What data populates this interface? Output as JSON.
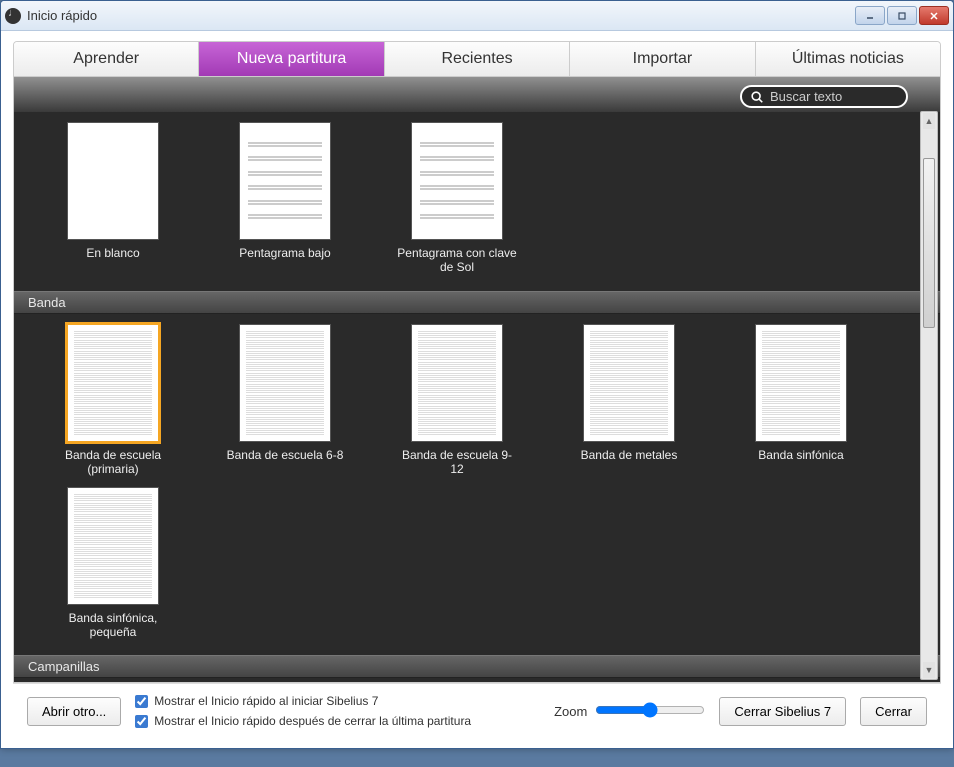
{
  "window": {
    "title": "Inicio rápido"
  },
  "tabs": [
    {
      "label": "Aprender"
    },
    {
      "label": "Nueva partitura",
      "active": true
    },
    {
      "label": "Recientes"
    },
    {
      "label": "Importar"
    },
    {
      "label": "Últimas noticias"
    }
  ],
  "search": {
    "placeholder": "Buscar texto"
  },
  "section_top_items": [
    {
      "label": "En blanco",
      "style": "blank"
    },
    {
      "label": "Pentagrama bajo",
      "style": "sparse"
    },
    {
      "label": "Pentagrama con clave de Sol",
      "style": "sparse"
    }
  ],
  "section_banda": {
    "title": "Banda",
    "items": [
      {
        "label": "Banda de escuela (primaria)",
        "style": "dense",
        "selected": true
      },
      {
        "label": "Banda de escuela 6-8",
        "style": "dense"
      },
      {
        "label": "Banda de escuela 9-12",
        "style": "dense"
      },
      {
        "label": "Banda de metales",
        "style": "dense"
      },
      {
        "label": "Banda sinfónica",
        "style": "dense"
      },
      {
        "label": "Banda sinfónica, pequeña",
        "style": "dense"
      }
    ]
  },
  "section_campanillas": {
    "title": "Campanillas"
  },
  "footer": {
    "open_other": "Abrir otro...",
    "check1": "Mostrar el Inicio rápido al iniciar Sibelius 7",
    "check2": "Mostrar el Inicio rápido después de cerrar la última partitura",
    "zoom_label": "Zoom",
    "close_app": "Cerrar Sibelius 7",
    "close": "Cerrar"
  }
}
